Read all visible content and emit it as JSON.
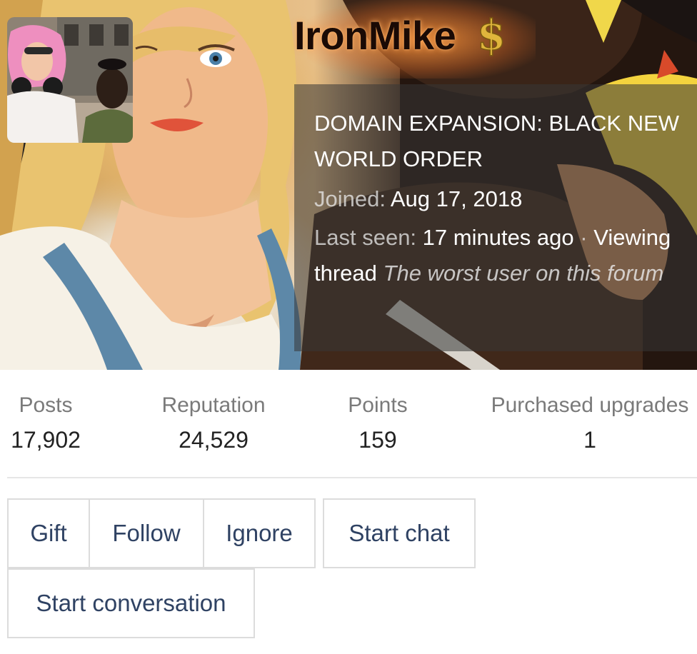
{
  "profile": {
    "username": "IronMike",
    "user_title": "DOMAIN EXPANSION: BLACK NEW WORLD ORDER",
    "joined_label": "Joined:",
    "joined_value": "Aug 17, 2018",
    "last_seen_label": "Last seen:",
    "last_seen_value": "17 minutes ago",
    "separator": "·",
    "activity": "Viewing thread",
    "thread_title": "The worst user on this forum",
    "badge_icon": "dollar-sign-icon"
  },
  "stats": [
    {
      "label": "Posts",
      "value": "17,902"
    },
    {
      "label": "Reputation",
      "value": "24,529"
    },
    {
      "label": "Points",
      "value": "159"
    },
    {
      "label": "Purchased upgrades",
      "value": "1"
    }
  ],
  "actions": {
    "gift": "Gift",
    "follow": "Follow",
    "ignore": "Ignore",
    "start_chat": "Start chat",
    "start_conversation": "Start conversation"
  },
  "colors": {
    "button_text": "#2f4263",
    "button_border": "#dcdcdc",
    "stat_label": "#7a7a7a",
    "badge": "#e0b53c"
  }
}
